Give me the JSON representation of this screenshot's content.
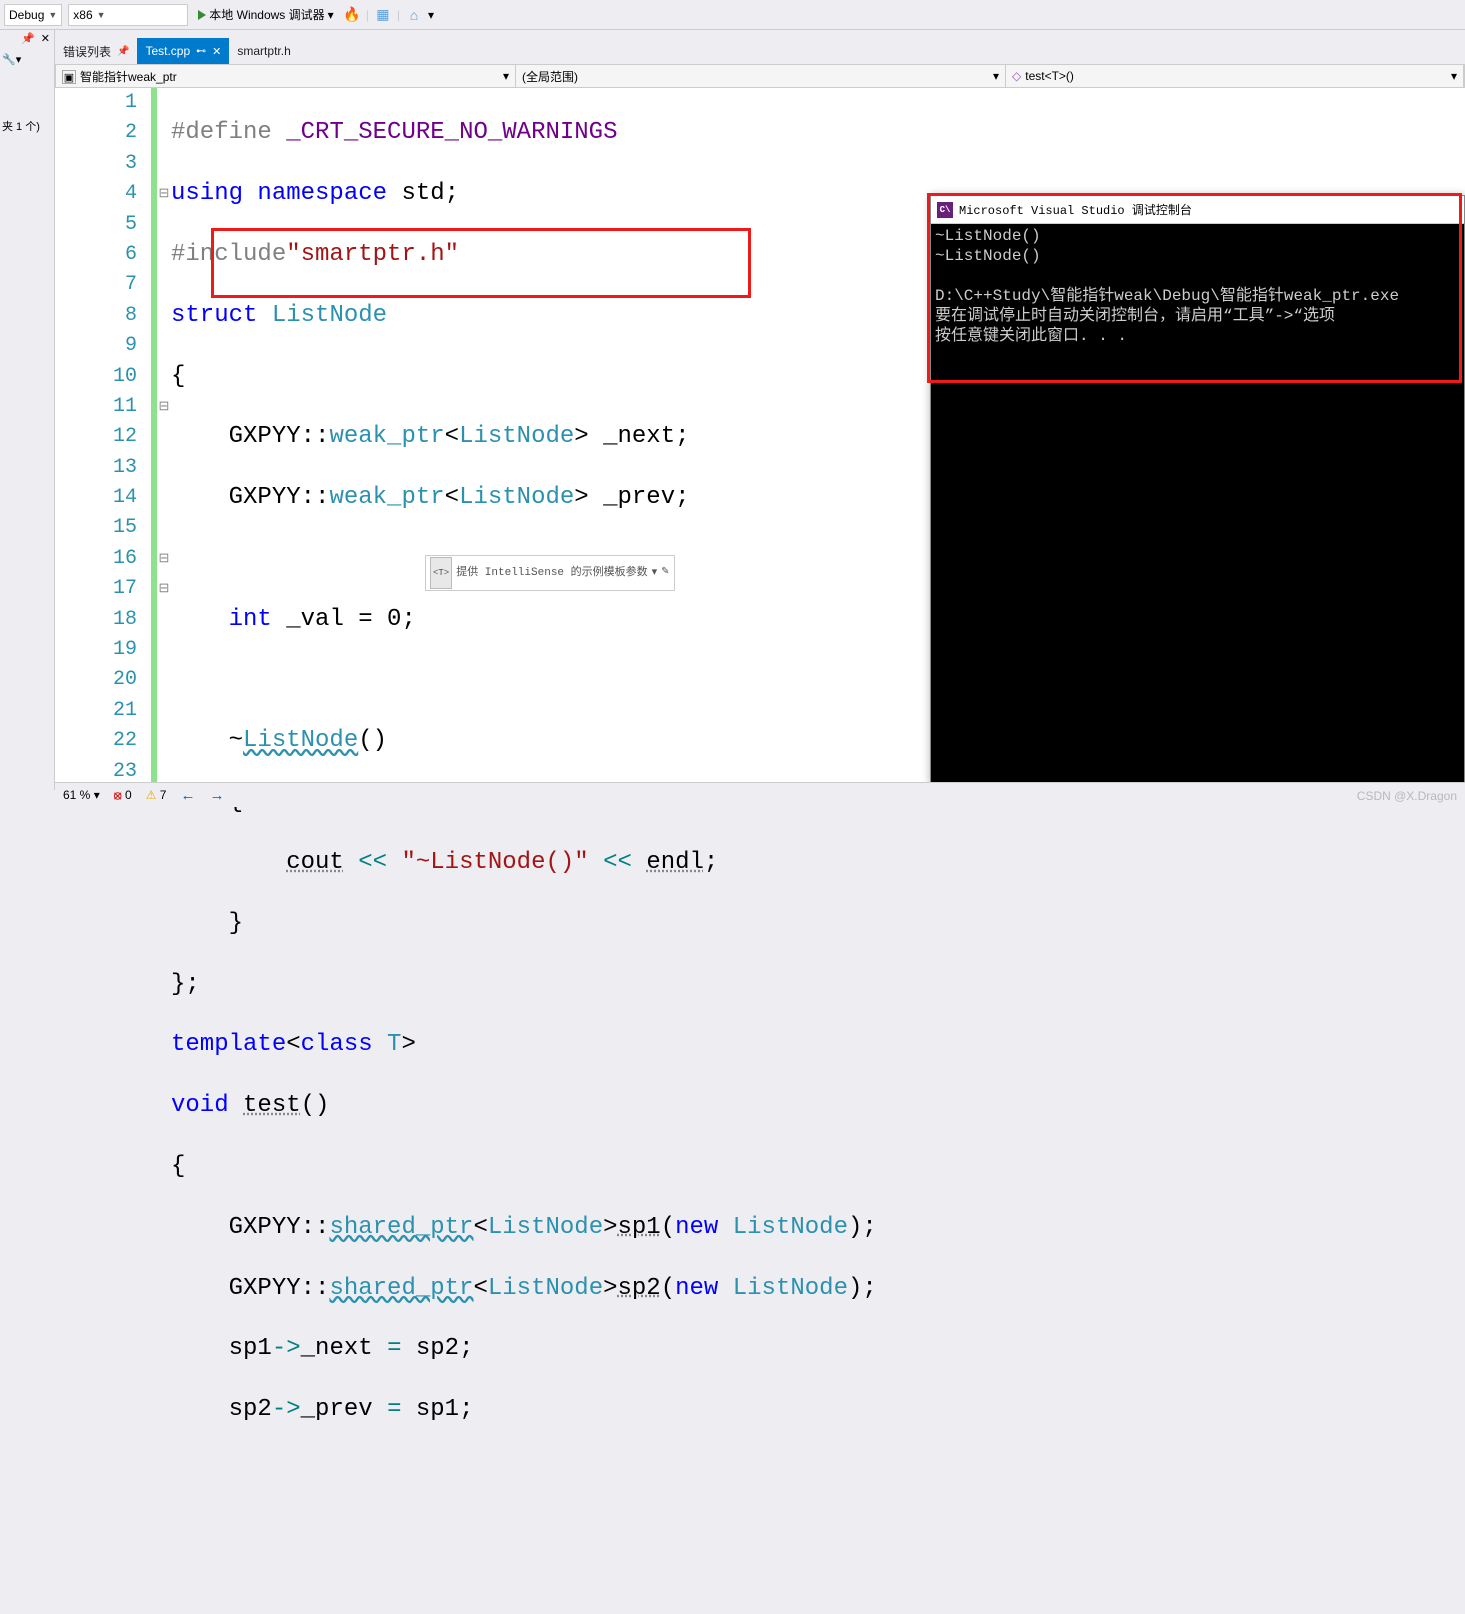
{
  "toolbar": {
    "config": "Debug",
    "platform": "x86",
    "debug_label": "本地 Windows 调试器"
  },
  "side": {
    "count_text": "夹 1 个)"
  },
  "tabs": {
    "error_list": "错误列表",
    "active": "Test.cpp",
    "inactive2": "smartptr.h"
  },
  "nav": {
    "left": "智能指针weak_ptr",
    "mid": "(全局范围)",
    "right": "test<T>()"
  },
  "lines": [
    "1",
    "2",
    "3",
    "4",
    "5",
    "6",
    "7",
    "8",
    "9",
    "10",
    "11",
    "12",
    "13",
    "14",
    "15",
    "16",
    "17",
    "18",
    "19",
    "20",
    "21",
    "22",
    "23"
  ],
  "fold": [
    "",
    "",
    "",
    "⊟",
    "",
    "",
    "",
    "",
    "",
    "",
    "⊟",
    "",
    "",
    "",
    "",
    "⊟",
    "⊟",
    "",
    "",
    "",
    "",
    "",
    ""
  ],
  "code": {
    "l1a": "#define",
    "l1b": "_CRT_SECURE_NO_WARNINGS",
    "l2a": "using",
    "l2b": "namespace",
    "l2c": " std;",
    "l3a": "#include",
    "l3b": "\"smartptr.h\"",
    "l4a": "struct",
    "l4b": "ListNode",
    "l5": "{",
    "l6a": "    GXPYY::",
    "l6b": "weak_ptr",
    "l6c": "<",
    "l6d": "ListNode",
    "l6e": "> _next;",
    "l7a": "    GXPYY::",
    "l7b": "weak_ptr",
    "l7c": "<",
    "l7d": "ListNode",
    "l7e": "> _prev;",
    "l8": "",
    "l9a": "    ",
    "l9b": "int",
    "l9c": " _val = ",
    "l9d": "0",
    "l9e": ";",
    "l10": "",
    "l11a": "    ~",
    "l11b": "ListNode",
    "l11c": "()",
    "l12": "    {",
    "l13a": "        ",
    "l13b": "cout",
    "l13c": " ",
    "l13op1": "<<",
    "l13d": " ",
    "l13e": "\"~ListNode()\"",
    "l13f": " ",
    "l13op2": "<<",
    "l13g": " ",
    "l13h": "endl",
    "l13i": ";",
    "l14": "    }",
    "l15": "};",
    "l16a": "template",
    "l16b": "<",
    "l16c": "class",
    "l16d": " ",
    "l16e": "T",
    "l16f": ">",
    "l17a": "void",
    "l17b": " ",
    "l17c": "test",
    "l17d": "()",
    "l18": "{",
    "l19a": "    GXPYY::",
    "l19b": "shared_ptr",
    "l19c": "<",
    "l19d": "ListNode",
    "l19e": ">",
    "l19f": "sp1",
    "l19g": "(",
    "l19h": "new",
    "l19i": " ",
    "l19j": "ListNode",
    "l19k": ");",
    "l20a": "    GXPYY::",
    "l20b": "shared_ptr",
    "l20c": "<",
    "l20d": "ListNode",
    "l20e": ">",
    "l20f": "sp2",
    "l20g": "(",
    "l20h": "new",
    "l20i": " ",
    "l20j": "ListNode",
    "l20k": ");",
    "l21a": "    sp1",
    "l21b": "->",
    "l21c": "_next ",
    "l21d": "=",
    "l21e": " sp2;",
    "l22a": "    sp2",
    "l22b": "->",
    "l22c": "_prev ",
    "l22d": "=",
    "l22e": " sp1;",
    "l23": ""
  },
  "hint": {
    "tag": "<T>",
    "text": "提供 IntelliSense 的示例模板参数",
    "caret": "▾",
    "pen": "✎"
  },
  "console": {
    "title": "Microsoft Visual Studio 调试控制台",
    "body": "~ListNode()\n~ListNode()\n\nD:\\C++Study\\智能指针weak\\Debug\\智能指针weak_ptr.exe \n要在调试停止时自动关闭控制台，请启用“工具”->“选项\n按任意键关闭此窗口. . ."
  },
  "status": {
    "zoom": "61 %",
    "errors": "0",
    "warnings": "7"
  },
  "watermark": "CSDN @X.Dragon"
}
